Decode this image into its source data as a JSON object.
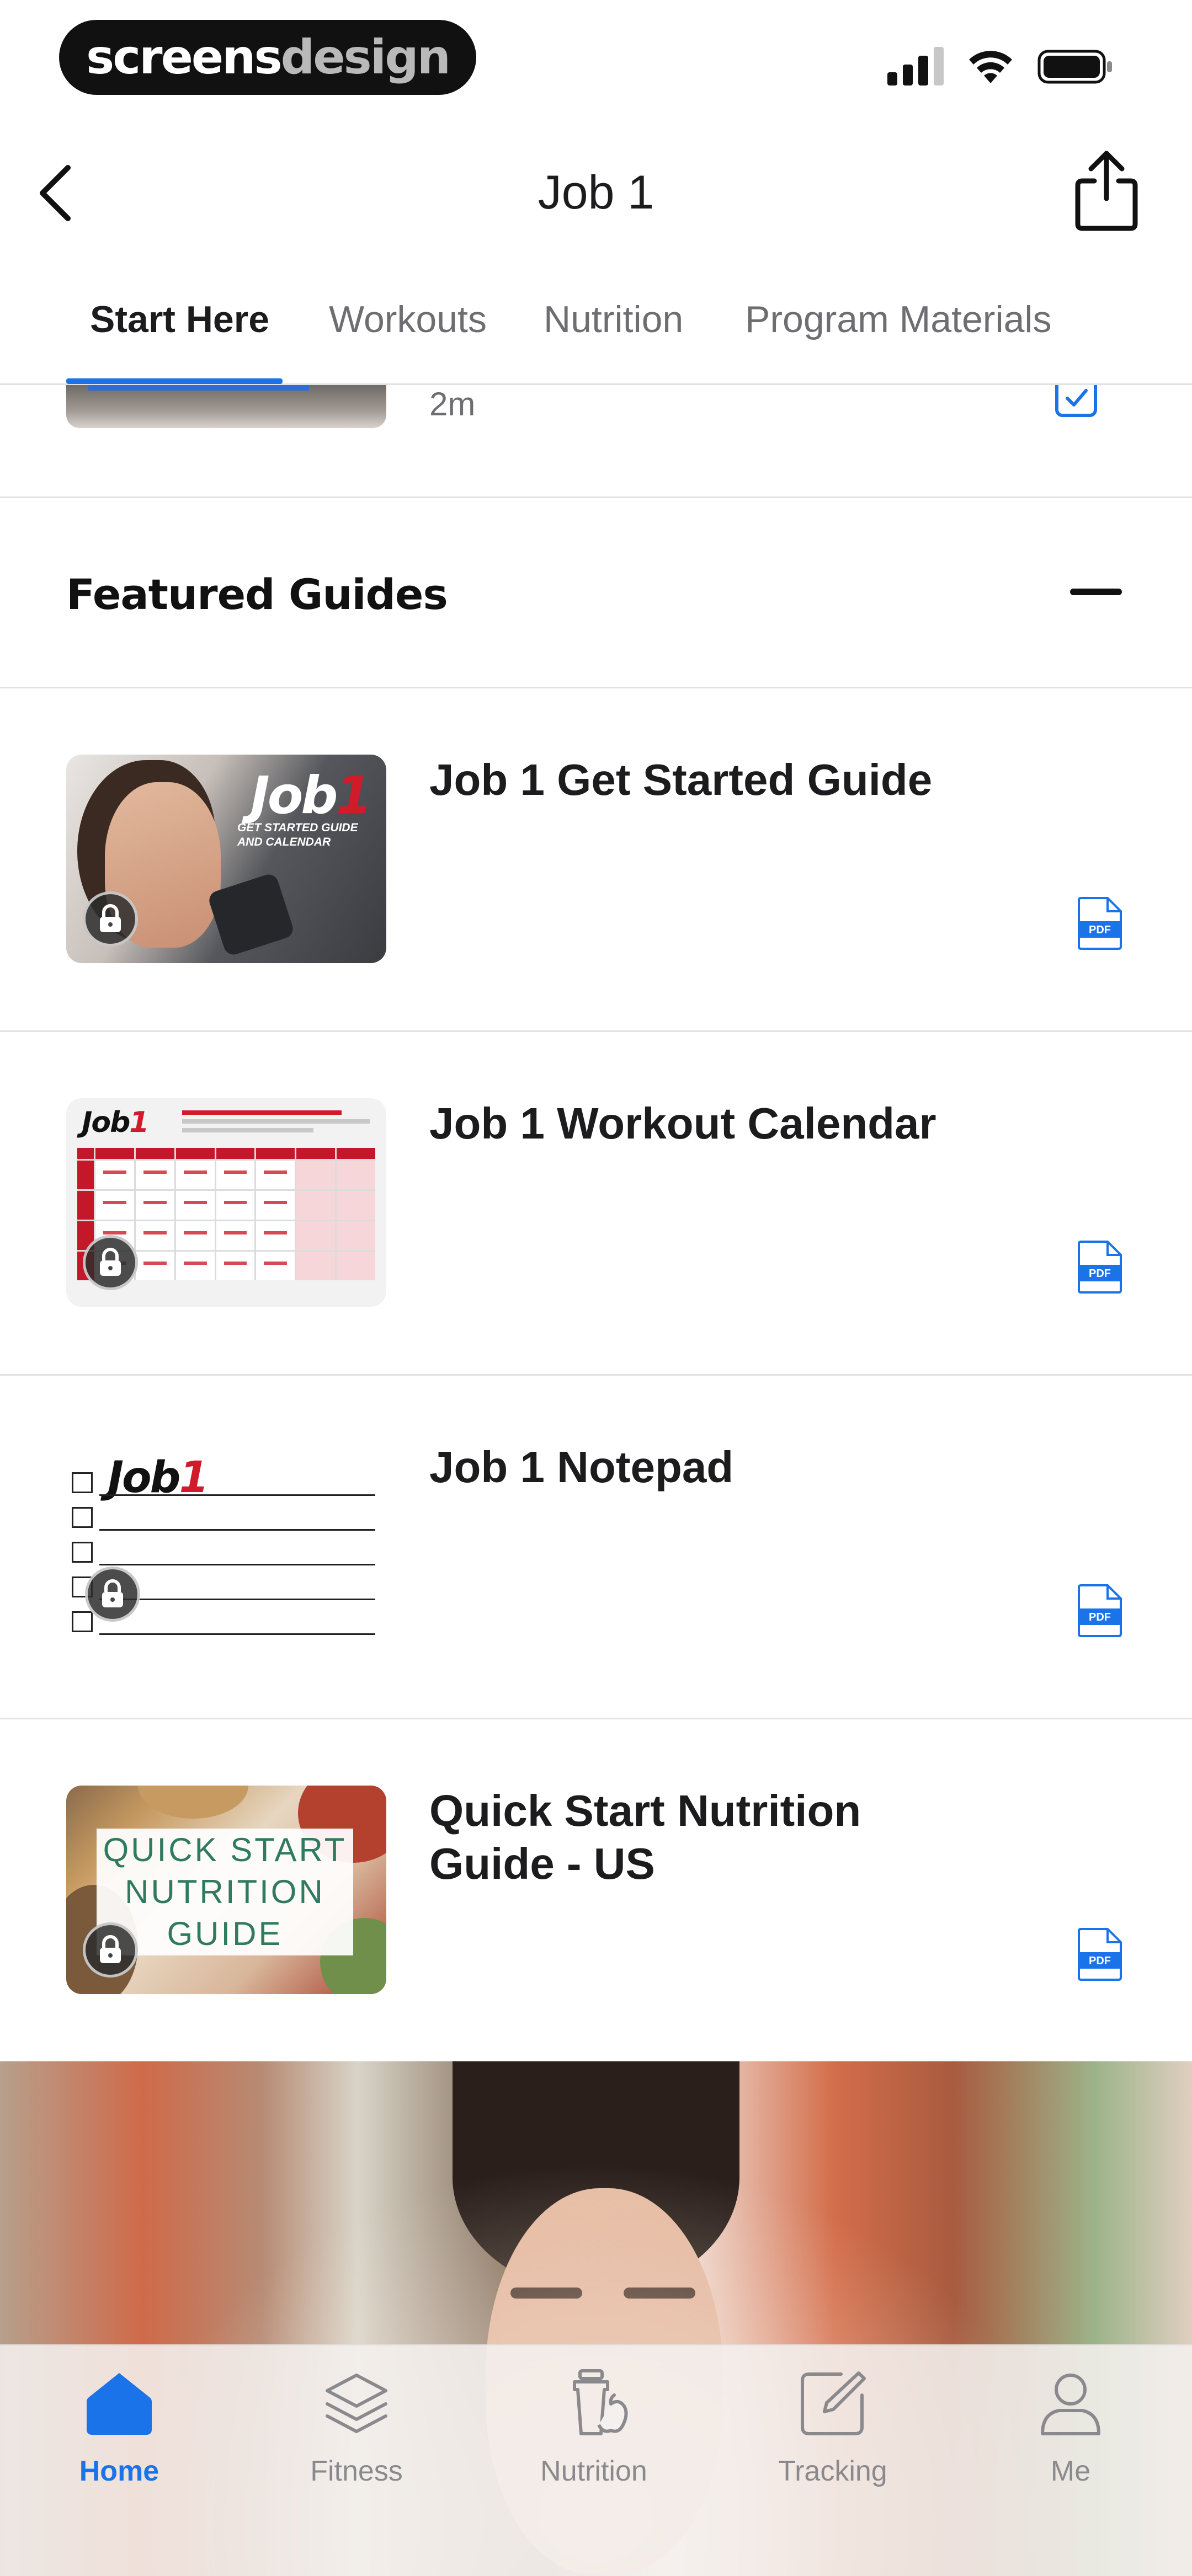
{
  "status_bar": {
    "brand": {
      "part1": "screens",
      "part2": "design"
    },
    "icons": [
      "cellular-signal-icon",
      "wifi-icon",
      "battery-icon"
    ]
  },
  "header": {
    "title": "Job 1",
    "back_icon": "chevron-left-icon",
    "share_icon": "share-icon"
  },
  "tabs": [
    {
      "label": "Start Here",
      "active": true
    },
    {
      "label": "Workouts",
      "active": false
    },
    {
      "label": "Nutrition",
      "active": false
    },
    {
      "label": "Program Materials",
      "active": false
    }
  ],
  "partial_row": {
    "duration": "2m",
    "icon": "bookmark-check-icon"
  },
  "section": {
    "title": "Featured Guides",
    "collapse_icon": "minus-icon"
  },
  "guides": [
    {
      "title": "Job 1 Get Started Guide",
      "thumb_logo_a": "Job",
      "thumb_logo_b": "1",
      "thumb_caption": "GET STARTED GUIDE AND CALENDAR",
      "icon": "pdf-icon",
      "locked": true
    },
    {
      "title": "Job 1 Workout Calendar",
      "thumb_logo_a": "Job",
      "thumb_logo_b": "1",
      "icon": "pdf-icon",
      "locked": true
    },
    {
      "title": "Job 1 Notepad",
      "thumb_logo_a": "Job",
      "thumb_logo_b": "1",
      "icon": "pdf-icon",
      "locked": true
    },
    {
      "title": "Quick Start Nutrition Guide - US",
      "thumb_lines": [
        "QUICK START",
        "NUTRITION",
        "GUIDE"
      ],
      "icon": "pdf-icon",
      "locked": true
    }
  ],
  "tab_bar": [
    {
      "label": "Home",
      "icon": "home-icon",
      "active": true
    },
    {
      "label": "Fitness",
      "icon": "layers-icon",
      "active": false
    },
    {
      "label": "Nutrition",
      "icon": "nutrition-shaker-apple-icon",
      "active": false
    },
    {
      "label": "Tracking",
      "icon": "edit-square-icon",
      "active": false
    },
    {
      "label": "Me",
      "icon": "person-icon",
      "active": false
    }
  ],
  "colors": {
    "accent": "#1a73e8",
    "brand_red": "#d11b2b",
    "divider": "#e2e2e2",
    "inactive_text": "#6d6d72",
    "nutrition_green": "#2f7a61"
  }
}
